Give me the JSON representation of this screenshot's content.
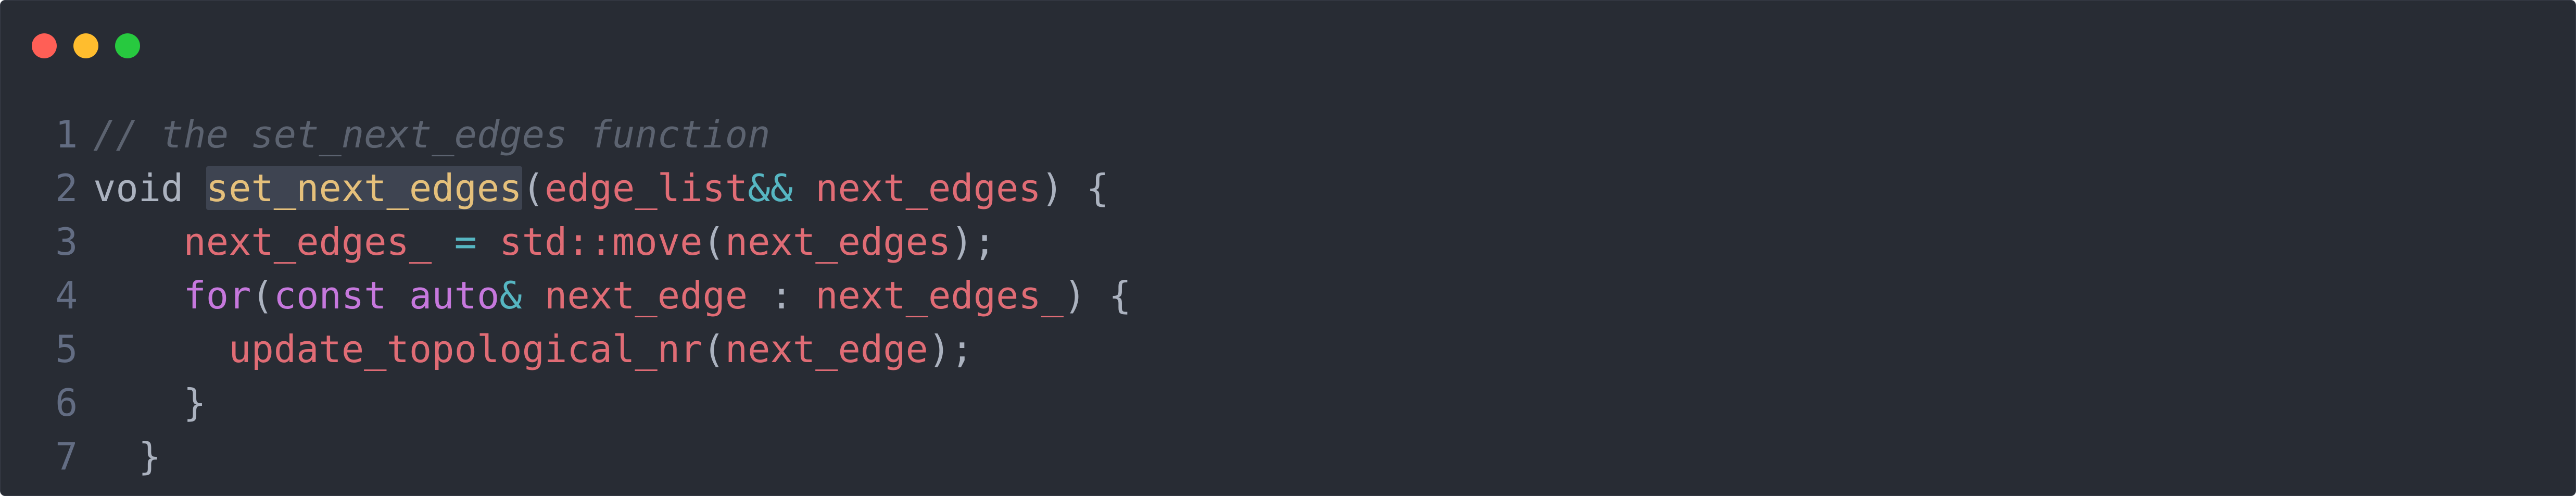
{
  "window": {
    "controls": [
      {
        "name": "close",
        "color": "#ff5f56"
      },
      {
        "name": "minimize",
        "color": "#ffbd2e"
      },
      {
        "name": "maximize",
        "color": "#27c93f"
      }
    ]
  },
  "code": {
    "lines": [
      {
        "number": "1",
        "tokens": [
          {
            "t": "// the set_next_edges function",
            "k": "comment"
          }
        ]
      },
      {
        "number": "2",
        "tokens": [
          {
            "t": "void ",
            "k": "plain"
          },
          {
            "t": "set_next_edges",
            "k": "func-hl"
          },
          {
            "t": "(",
            "k": "plain"
          },
          {
            "t": "edge_list",
            "k": "var"
          },
          {
            "t": "&&",
            "k": "op"
          },
          {
            "t": " ",
            "k": "plain"
          },
          {
            "t": "next_edges",
            "k": "var"
          },
          {
            "t": ") {",
            "k": "plain"
          }
        ]
      },
      {
        "number": "3",
        "tokens": [
          {
            "t": "    ",
            "k": "plain"
          },
          {
            "t": "next_edges_",
            "k": "var"
          },
          {
            "t": " ",
            "k": "plain"
          },
          {
            "t": "=",
            "k": "op"
          },
          {
            "t": " ",
            "k": "plain"
          },
          {
            "t": "std::move",
            "k": "var"
          },
          {
            "t": "(",
            "k": "plain"
          },
          {
            "t": "next_edges",
            "k": "var"
          },
          {
            "t": ");",
            "k": "plain"
          }
        ]
      },
      {
        "number": "4",
        "tokens": [
          {
            "t": "    ",
            "k": "plain"
          },
          {
            "t": "for",
            "k": "kw"
          },
          {
            "t": "(",
            "k": "plain"
          },
          {
            "t": "const",
            "k": "kw"
          },
          {
            "t": " ",
            "k": "plain"
          },
          {
            "t": "auto",
            "k": "kw"
          },
          {
            "t": "&",
            "k": "op"
          },
          {
            "t": " ",
            "k": "plain"
          },
          {
            "t": "next_edge",
            "k": "var"
          },
          {
            "t": " : ",
            "k": "plain"
          },
          {
            "t": "next_edges_",
            "k": "var"
          },
          {
            "t": ") {",
            "k": "plain"
          }
        ]
      },
      {
        "number": "5",
        "tokens": [
          {
            "t": "      ",
            "k": "plain"
          },
          {
            "t": "update_topological_nr",
            "k": "var"
          },
          {
            "t": "(",
            "k": "plain"
          },
          {
            "t": "next_edge",
            "k": "var"
          },
          {
            "t": ");",
            "k": "plain"
          }
        ]
      },
      {
        "number": "6",
        "tokens": [
          {
            "t": "    }",
            "k": "plain"
          }
        ]
      },
      {
        "number": "7",
        "tokens": [
          {
            "t": "  }",
            "k": "plain"
          }
        ]
      }
    ]
  }
}
